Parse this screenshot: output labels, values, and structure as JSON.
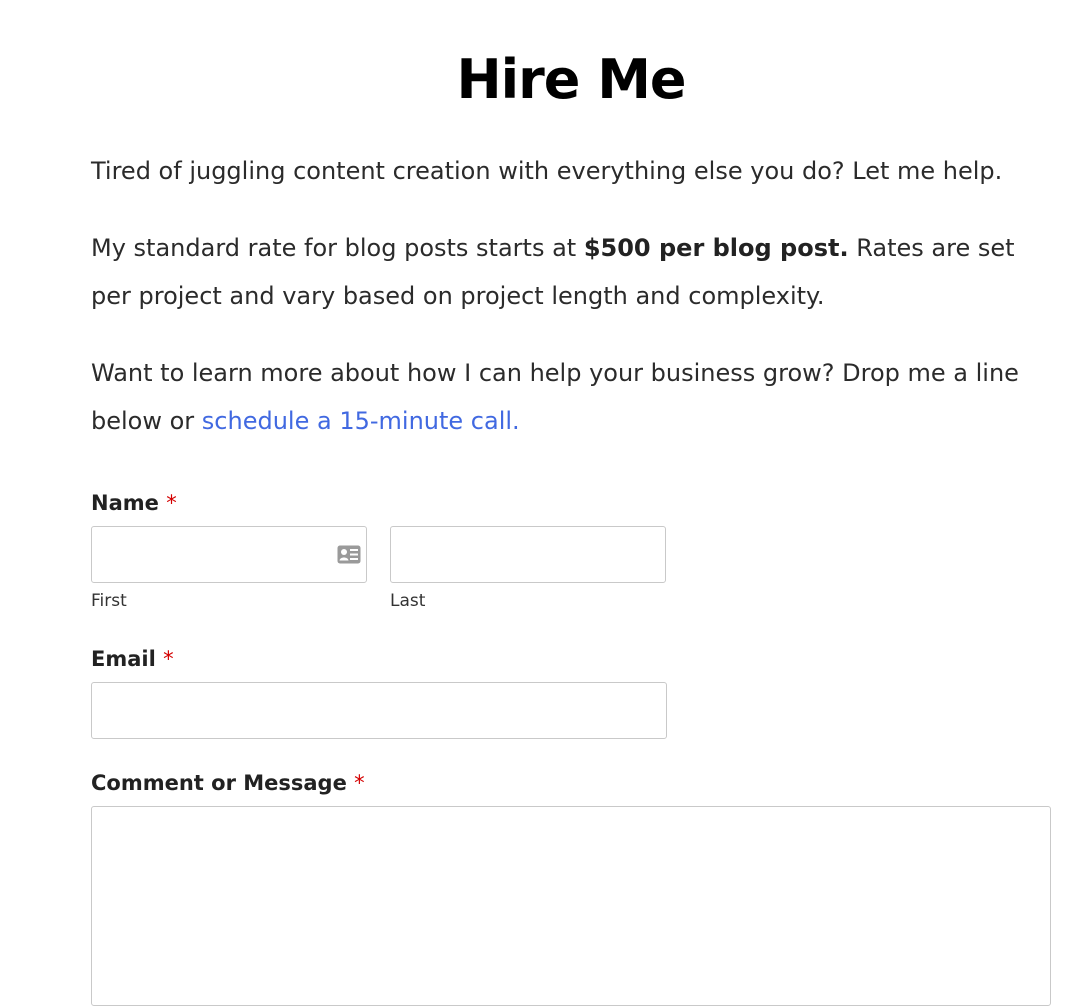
{
  "page": {
    "title": "Hire Me",
    "intro": "Tired of juggling content creation with everything else you do? Let me help.",
    "rate": {
      "prefix": "My standard rate for blog posts starts at ",
      "highlight": "$500 per blog post.",
      "suffix": " Rates are set per project and vary based on project length and complexity."
    },
    "cta": {
      "text": "Want to learn more about how I can help your business grow? Drop me a line below or ",
      "link_text": "schedule a 15-minute call."
    }
  },
  "form": {
    "required_marker": "*",
    "name": {
      "label": "Name",
      "first_sublabel": "First",
      "last_sublabel": "Last",
      "first_value": "",
      "last_value": "",
      "autofill_icon": "contact-card-icon"
    },
    "email": {
      "label": "Email",
      "value": ""
    },
    "message": {
      "label": "Comment or Message",
      "value": ""
    }
  },
  "colors": {
    "link": "#4169e1",
    "required": "#d40000",
    "text": "#2b2b2b",
    "border": "#c9c9c9"
  }
}
